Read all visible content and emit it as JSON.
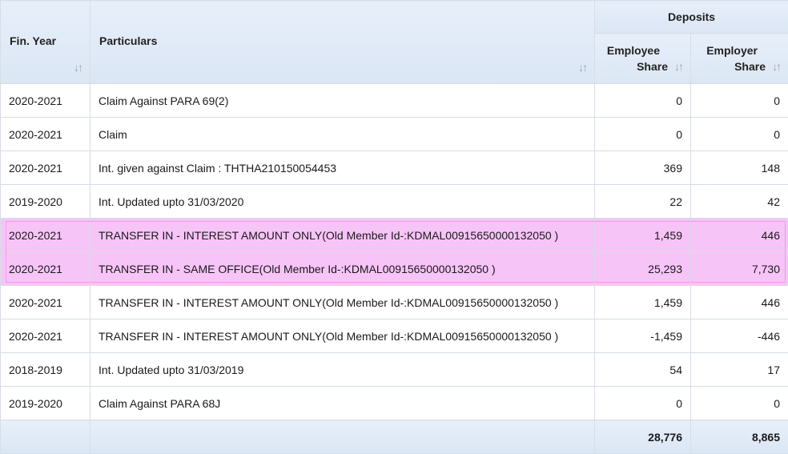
{
  "columns": {
    "fin_year": "Fin. Year",
    "particulars": "Particulars",
    "deposits": "Deposits",
    "employee_share": [
      "Employee",
      "Share"
    ],
    "employer_share": [
      "Employer",
      "Share"
    ],
    "sort_icon": "sort-arrows-icon"
  },
  "rows": [
    {
      "year": "2020-2021",
      "particulars": "Claim Against PARA 69(2)",
      "employee": "0",
      "employer": "0"
    },
    {
      "year": "2020-2021",
      "particulars": "Claim",
      "employee": "0",
      "employer": "0"
    },
    {
      "year": "2020-2021",
      "particulars": "Int. given against Claim : THTHA210150054453",
      "employee": "369",
      "employer": "148"
    },
    {
      "year": "2019-2020",
      "particulars": "Int. Updated upto 31/03/2020",
      "employee": "22",
      "employer": "42"
    },
    {
      "year": "2020-2021",
      "particulars": "TRANSFER IN - INTEREST AMOUNT ONLY(Old Member Id-:KDMAL00915650000132050 )",
      "employee": "1,459",
      "employer": "446"
    },
    {
      "year": "2020-2021",
      "particulars": "TRANSFER IN - SAME OFFICE(Old Member Id-:KDMAL00915650000132050 )",
      "employee": "25,293",
      "employer": "7,730"
    },
    {
      "year": "2020-2021",
      "particulars": "TRANSFER IN - INTEREST AMOUNT ONLY(Old Member Id-:KDMAL00915650000132050 )",
      "employee": "1,459",
      "employer": "446"
    },
    {
      "year": "2020-2021",
      "particulars": "TRANSFER IN - INTEREST AMOUNT ONLY(Old Member Id-:KDMAL00915650000132050 )",
      "employee": "-1,459",
      "employer": "-446"
    },
    {
      "year": "2018-2019",
      "particulars": "Int. Updated upto 31/03/2019",
      "employee": "54",
      "employer": "17"
    },
    {
      "year": "2019-2020",
      "particulars": "Claim Against PARA 68J",
      "employee": "0",
      "employer": "0"
    }
  ],
  "highlighted_rows": [
    4,
    5
  ],
  "highlight_color": "#f7c4f7",
  "header_color": "#dbe6f4",
  "totals": {
    "employee": "28,776",
    "employer": "8,865"
  }
}
